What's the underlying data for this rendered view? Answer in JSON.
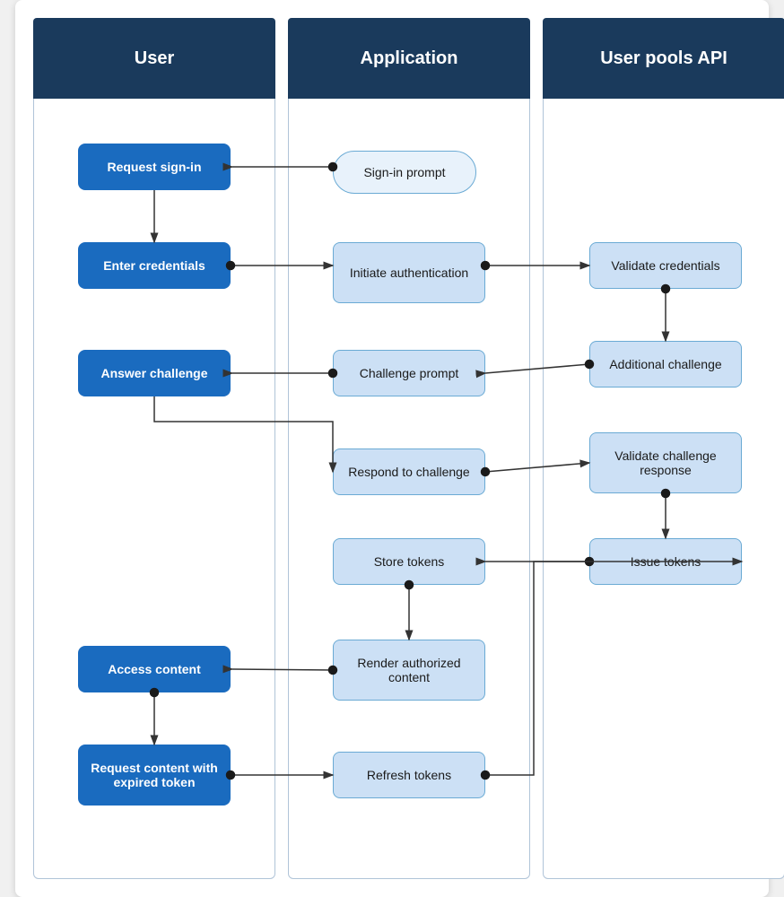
{
  "columns": [
    {
      "id": "user",
      "label": "User"
    },
    {
      "id": "application",
      "label": "Application"
    },
    {
      "id": "api",
      "label": "User pools API"
    }
  ],
  "nodes": {
    "request_signin": {
      "label": "Request sign-in"
    },
    "enter_credentials": {
      "label": "Enter credentials"
    },
    "answer_challenge": {
      "label": "Answer challenge"
    },
    "access_content": {
      "label": "Access content"
    },
    "request_expired": {
      "label": "Request content with expired token"
    },
    "signin_prompt": {
      "label": "Sign-in prompt"
    },
    "initiate_auth": {
      "label": "Initiate authentication"
    },
    "challenge_prompt": {
      "label": "Challenge prompt"
    },
    "respond_challenge": {
      "label": "Respond to challenge"
    },
    "store_tokens": {
      "label": "Store tokens"
    },
    "render_authorized": {
      "label": "Render authorized content"
    },
    "refresh_tokens": {
      "label": "Refresh tokens"
    },
    "validate_credentials": {
      "label": "Validate credentials"
    },
    "additional_challenge": {
      "label": "Additional challenge"
    },
    "validate_challenge": {
      "label": "Validate challenge response"
    },
    "issue_tokens": {
      "label": "Issue tokens"
    }
  }
}
